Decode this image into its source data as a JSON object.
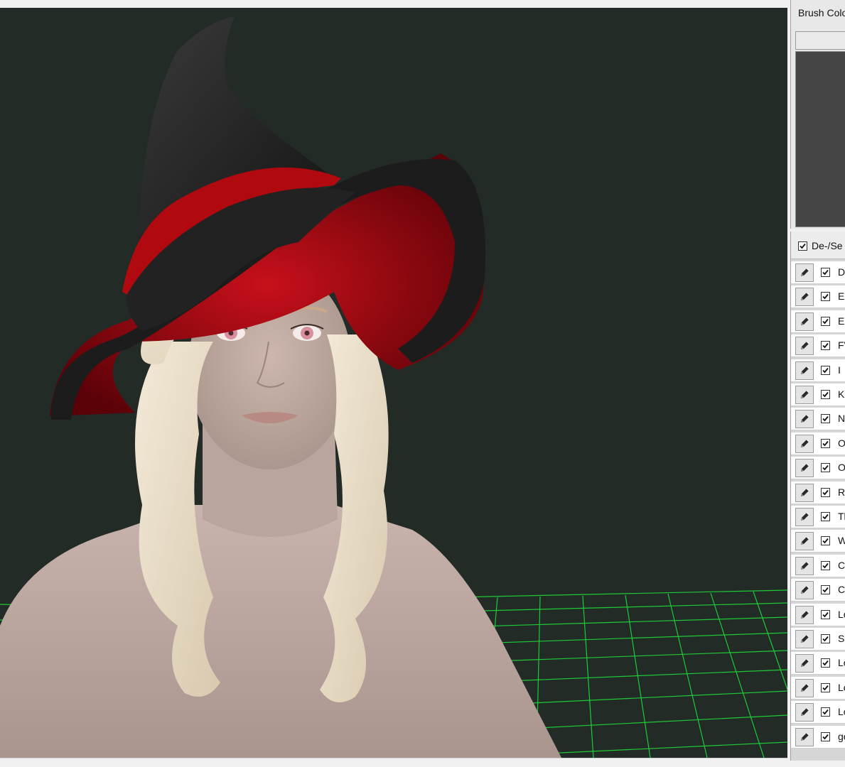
{
  "brush_panel": {
    "title": "Brush Colo",
    "swatch_color": "#eaeaea",
    "preview_color": "#454545"
  },
  "layers": {
    "header_label": "De-/Se",
    "header_checked": true,
    "items": [
      {
        "name": "DS",
        "checked": true
      },
      {
        "name": "Ee",
        "checked": true
      },
      {
        "name": "Eh",
        "checked": true
      },
      {
        "name": "FV",
        "checked": true
      },
      {
        "name": "I",
        "checked": true
      },
      {
        "name": "K",
        "checked": true
      },
      {
        "name": "N",
        "checked": true
      },
      {
        "name": "OI",
        "checked": true
      },
      {
        "name": "Oc",
        "checked": true
      },
      {
        "name": "R",
        "checked": true
      },
      {
        "name": "Th",
        "checked": true
      },
      {
        "name": "W",
        "checked": true
      },
      {
        "name": "Co",
        "checked": true
      },
      {
        "name": "Co",
        "checked": true
      },
      {
        "name": "Lo",
        "checked": true
      },
      {
        "name": "Sk",
        "checked": true
      },
      {
        "name": "Lo",
        "checked": true
      },
      {
        "name": "Lo",
        "checked": true
      },
      {
        "name": "Lo",
        "checked": true
      },
      {
        "name": "go",
        "checked": true
      }
    ]
  },
  "viewport": {
    "background_color": "#232b27",
    "grid_color": "#1ee63c",
    "skin_color": "#c2aea6",
    "hair_color": "#e9dcc6",
    "hat_color": "#1e1e1e",
    "hat_band_color": "#b0090f",
    "eye_color": "#d9909e"
  }
}
